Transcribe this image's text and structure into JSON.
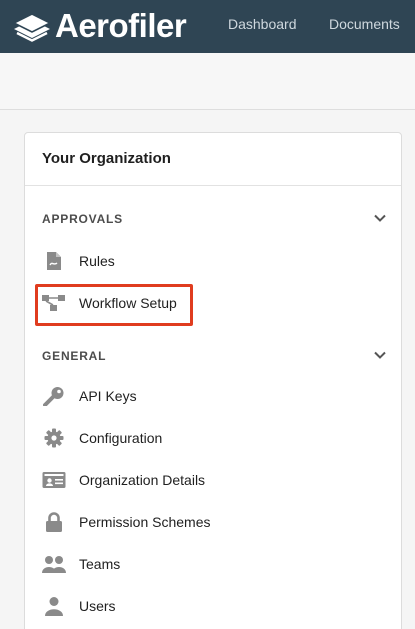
{
  "brand": {
    "name": "Aerofiler"
  },
  "nav": {
    "dashboard": "Dashboard",
    "documents": "Documents"
  },
  "card": {
    "title": "Your Organization"
  },
  "sections": {
    "approvals": {
      "label": "APPROVALS",
      "items": [
        {
          "label": "Rules",
          "icon": "pdf-file-icon"
        },
        {
          "label": "Workflow Setup",
          "icon": "workflow-icon",
          "highlighted": true
        }
      ]
    },
    "general": {
      "label": "GENERAL",
      "items": [
        {
          "label": "API Keys",
          "icon": "key-icon"
        },
        {
          "label": "Configuration",
          "icon": "gear-icon"
        },
        {
          "label": "Organization Details",
          "icon": "id-card-icon"
        },
        {
          "label": "Permission Schemes",
          "icon": "lock-icon"
        },
        {
          "label": "Teams",
          "icon": "users-icon"
        },
        {
          "label": "Users",
          "icon": "user-icon"
        }
      ]
    }
  },
  "colors": {
    "topbar": "#2f4554",
    "icon": "#8a8a8a",
    "highlight": "#e03c1f"
  }
}
